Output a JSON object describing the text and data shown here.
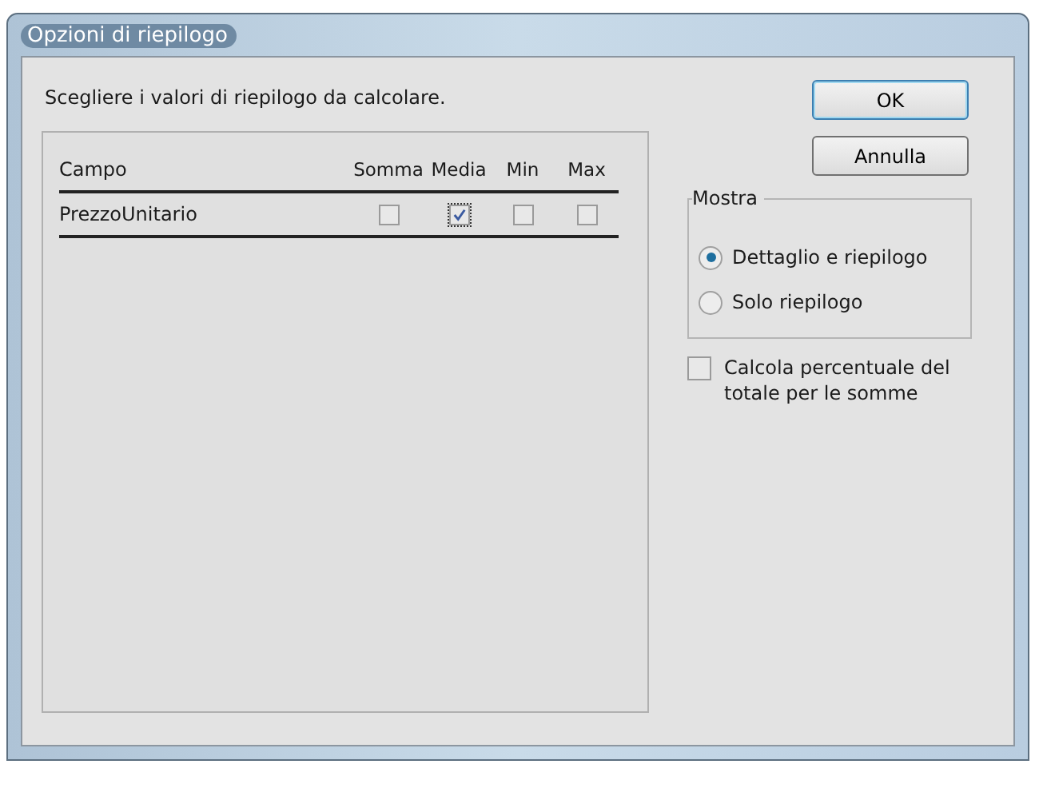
{
  "window": {
    "title": "Opzioni di riepilogo"
  },
  "instruction": "Scegliere i valori di riepilogo da calcolare.",
  "table": {
    "columns": [
      "Campo",
      "Somma",
      "Media",
      "Min",
      "Max"
    ],
    "rows": [
      {
        "field": "PrezzoUnitario",
        "checks": [
          {
            "checked": false
          },
          {
            "checked": true
          },
          {
            "checked": false
          },
          {
            "checked": false
          }
        ]
      }
    ]
  },
  "buttons": [
    "OK",
    "Annulla"
  ],
  "show_group": {
    "title": "Mostra",
    "options": [
      {
        "label": "Dettaglio e riepilogo",
        "selected": true
      },
      {
        "label": "Solo riepilogo",
        "selected": false
      }
    ]
  },
  "percent_option": {
    "label": "Calcola percentuale del totale per le somme",
    "checked": false
  }
}
